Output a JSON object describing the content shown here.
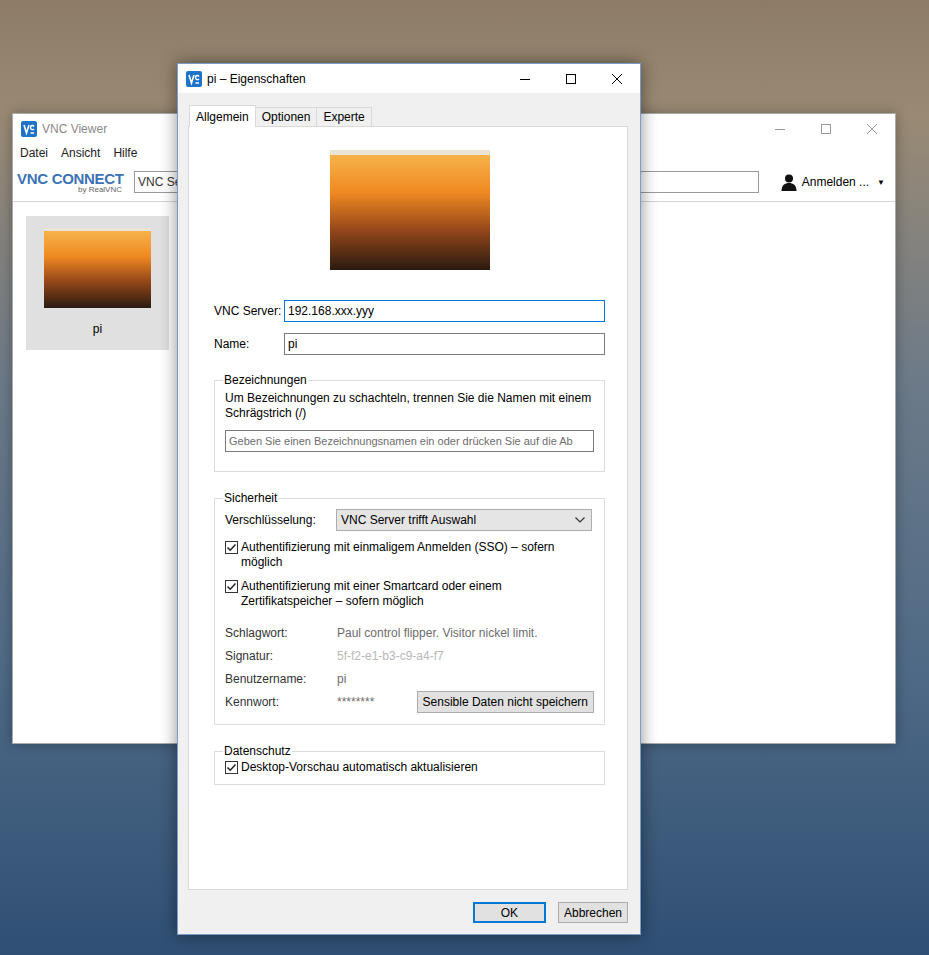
{
  "viewer_window": {
    "title": "VNC Viewer",
    "menu": [
      "Datei",
      "Ansicht",
      "Hilfe"
    ],
    "logo": {
      "brand": "VNC CONNECT",
      "by": "by RealVNC"
    },
    "search": {
      "value": "VNC Se"
    },
    "account": {
      "label": "Anmelden ...",
      "arrow": "▼"
    },
    "connections": [
      {
        "name": "pi",
        "selected": true
      }
    ]
  },
  "dialog": {
    "title": "pi – Eigenschaften",
    "tabs": [
      {
        "label": "Allgemein",
        "selected": true
      },
      {
        "label": "Optionen",
        "selected": false
      },
      {
        "label": "Experte",
        "selected": false
      }
    ],
    "fields": [
      {
        "label": "VNC Server:",
        "value": "192.168.xxx.yyy",
        "focused": true
      },
      {
        "label": "Name:",
        "value": "pi",
        "focused": false
      }
    ],
    "labels_group": {
      "title": "Bezeichnungen",
      "hint": "Um Bezeichnungen zu schachteln, trennen Sie die Namen mit einem Schrägstrich (/)",
      "placeholder": "Geben Sie einen Bezeichnungsnamen ein oder drücken Sie auf die Ab"
    },
    "security": {
      "title": "Sicherheit",
      "encryption": {
        "label": "Verschlüsselung:",
        "value": "VNC Server trifft Auswahl"
      },
      "checkboxes": [
        {
          "label": "Authentifizierung mit einmaligem Anmelden (SSO) – sofern möglich",
          "checked": true
        },
        {
          "label": "Authentifizierung mit einer Smartcard oder einem Zertifikatspeicher – sofern möglich",
          "checked": true
        }
      ],
      "info": [
        {
          "label": "Schlagwort:",
          "value": "Paul control flipper. Visitor nickel limit."
        },
        {
          "label": "Signatur:",
          "value": "5f-f2-e1-b3-c9-a4-f7"
        },
        {
          "label": "Benutzername:",
          "value": "pi"
        },
        {
          "label": "Kennwort:",
          "value": "********"
        }
      ],
      "forget_button": "Sensible Daten nicht speichern"
    },
    "privacy": {
      "title": "Datenschutz",
      "checkboxes": [
        {
          "label": "Desktop-Vorschau automatisch aktualisieren",
          "checked": true
        }
      ]
    },
    "buttons": [
      {
        "label": "OK",
        "default": true
      },
      {
        "label": "Abbrechen",
        "default": false
      }
    ]
  }
}
